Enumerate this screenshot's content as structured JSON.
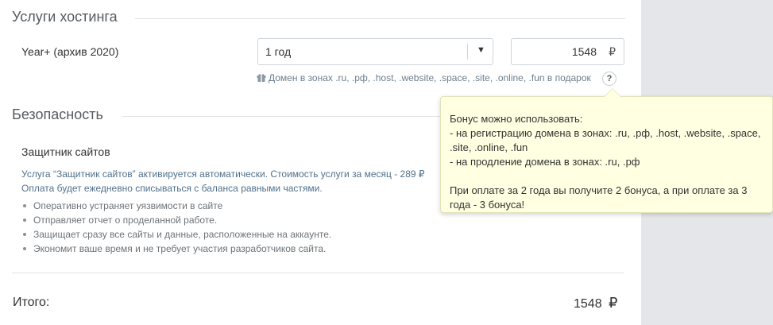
{
  "hosting": {
    "section_title": "Услуги хостинга",
    "product_name": "Year+ (архив 2020)",
    "period": "1 год",
    "price": "1548",
    "currency": "₽",
    "gift_note": "Домен в зонах .ru, .рф, .host, .website, .space, .site, .online, .fun в подарок",
    "help_label": "?"
  },
  "tooltip": {
    "line1": "Бонус можно использовать:",
    "line2": "- на регистрацию домена в зонах: .ru, .рф, .host, .website, .space,",
    "line3": ".site, .online, .fun",
    "line4": "- на продление домена в зонах: .ru, .рф",
    "line5": "При оплате за 2 года вы получите 2 бонуса, а при оплате за 3",
    "line6": "года - 3 бонуса!"
  },
  "security": {
    "section_title": "Безопасность",
    "protector_title": "Защитник сайтов",
    "desc_line1": "Услуга “Защитник сайтов” активируется автоматически. Стоимость услуги за месяц - 289 ₽",
    "desc_line2": "Оплата будет ежедневно списываться с баланса равными частями.",
    "features": [
      "Оперативно устраняет уязвимости в сайте",
      "Отправляет отчет о проделанной работе.",
      "Защищает сразу все сайты и данные, расположенные на аккаунте.",
      "Экономит ваше время и не требует участия разработчиков сайта."
    ]
  },
  "total": {
    "label": "Итого:",
    "amount": "1548",
    "currency": "₽"
  },
  "colors": {
    "tooltip_bg": "#ffffe2",
    "link_text": "#50708b",
    "side_panel": "#e4e6e9"
  },
  "icons": {
    "gift": "gift-icon",
    "dropdown": "chevron-down-icon",
    "help": "help-icon"
  }
}
